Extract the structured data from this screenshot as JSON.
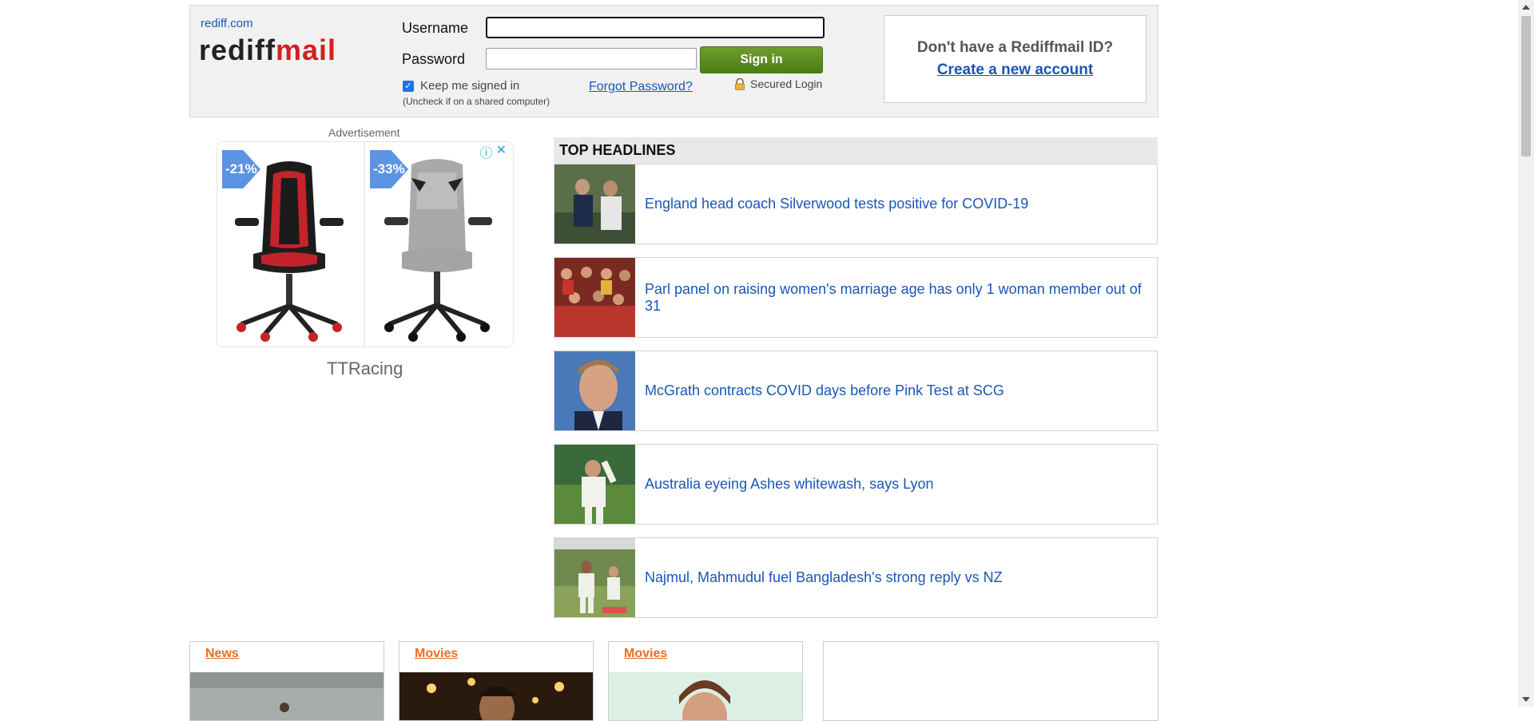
{
  "header": {
    "site_link": "rediff.com",
    "logo_part1": "rediff",
    "logo_part2": "mail",
    "username_label": "Username",
    "password_label": "Password",
    "username_value": "",
    "password_value": "",
    "signin_label": "Sign in",
    "keep_signed_in_label": "Keep me signed in",
    "keep_signed_in_checked": true,
    "uncheck_hint": "(Uncheck if on a shared computer)",
    "forgot_password": "Forgot Password?",
    "secured_login": "Secured Login"
  },
  "signup": {
    "question": "Don't have a Rediffmail ID?",
    "link": "Create a new account"
  },
  "advertisement": {
    "label": "Advertisement",
    "discount1": "-21%",
    "discount2": "-33%",
    "brand": "TTRacing"
  },
  "headlines": {
    "title": "TOP HEADLINES",
    "items": [
      {
        "text": "England head coach Silverwood tests positive for COVID-19"
      },
      {
        "text": "Parl panel on raising women's marriage age has only 1 woman member out of 31"
      },
      {
        "text": "McGrath contracts COVID days before Pink Test at SCG"
      },
      {
        "text": "Australia eyeing Ashes whitewash, says Lyon"
      },
      {
        "text": "Najmul, Mahmudul fuel Bangladesh's strong reply vs NZ"
      }
    ]
  },
  "tiles": [
    {
      "title": "News"
    },
    {
      "title": "Movies"
    },
    {
      "title": "Movies"
    }
  ],
  "colors": {
    "link_blue": "#1a56b8",
    "logo_red": "#d51f1f",
    "signin_green": "#5a8a1f",
    "tile_orange": "#ea6d1f"
  }
}
